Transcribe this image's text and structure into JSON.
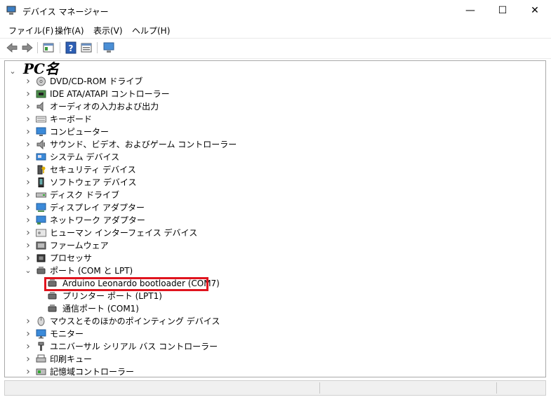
{
  "window": {
    "title": "デバイス マネージャー",
    "minimize_glyph": "—",
    "maximize_glyph": "☐",
    "close_glyph": "✕"
  },
  "menu": [
    "ファイル(F)",
    "操作(A)",
    "表示(V)",
    "ヘルプ(H)"
  ],
  "tree": {
    "root_label": "PC名",
    "items": [
      {
        "label": "DVD/CD-ROM ドライブ",
        "icon": "dvd-drive-icon"
      },
      {
        "label": "IDE ATA/ATAPI コントローラー",
        "icon": "ide-controller-icon"
      },
      {
        "label": "オーディオの入力および出力",
        "icon": "speaker-icon"
      },
      {
        "label": "キーボード",
        "icon": "keyboard-icon"
      },
      {
        "label": "コンピューター",
        "icon": "computer-icon"
      },
      {
        "label": "サウンド、ビデオ、およびゲーム コントローラー",
        "icon": "sound-icon"
      },
      {
        "label": "システム デバイス",
        "icon": "system-device-icon"
      },
      {
        "label": "セキュリティ デバイス",
        "icon": "security-device-icon"
      },
      {
        "label": "ソフトウェア デバイス",
        "icon": "software-device-icon"
      },
      {
        "label": "ディスク ドライブ",
        "icon": "disk-drive-icon"
      },
      {
        "label": "ディスプレイ アダプター",
        "icon": "display-adapter-icon"
      },
      {
        "label": "ネットワーク アダプター",
        "icon": "network-adapter-icon"
      },
      {
        "label": "ヒューマン インターフェイス デバイス",
        "icon": "hid-icon"
      },
      {
        "label": "ファームウェア",
        "icon": "firmware-icon"
      },
      {
        "label": "プロセッサ",
        "icon": "processor-icon"
      },
      {
        "label": "ポート (COM と LPT)",
        "icon": "port-icon",
        "expanded": true
      },
      {
        "label": "Arduino Leonardo bootloader (COM7)",
        "icon": "port-icon",
        "child": true,
        "highlight": true
      },
      {
        "label": "プリンター ポート (LPT1)",
        "icon": "port-icon",
        "child": true
      },
      {
        "label": "通信ポート (COM1)",
        "icon": "port-icon",
        "child": true
      },
      {
        "label": "マウスとそのほかのポインティング デバイス",
        "icon": "mouse-icon"
      },
      {
        "label": "モニター",
        "icon": "monitor-icon"
      },
      {
        "label": "ユニバーサル シリアル バス コントローラー",
        "icon": "usb-icon"
      },
      {
        "label": "印刷キュー",
        "icon": "print-queue-icon"
      },
      {
        "label": "記憶域コントローラー",
        "icon": "storage-controller-icon"
      }
    ]
  },
  "colors": {
    "highlight_border": "#e0141e"
  }
}
